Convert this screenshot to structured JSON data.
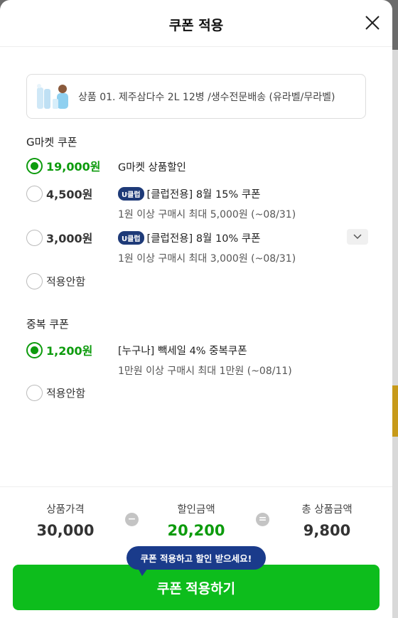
{
  "header": {
    "title": "쿠폰 적용"
  },
  "product": {
    "name": "상품 01. 제주삼다수 2L 12병 /생수전문배송 (유라벨/무라벨)"
  },
  "gmarket_coupons": {
    "title": "G마켓 쿠폰",
    "options": [
      {
        "amount": "19,000원",
        "selected": true,
        "badge": "",
        "desc": "G마켓 상품할인",
        "sub": ""
      },
      {
        "amount": "4,500원",
        "selected": false,
        "badge": "U클럽",
        "desc": "[클럽전용] 8월 15% 쿠폰",
        "sub": "1원 이상 구매시 최대 5,000원 (~08/31)"
      },
      {
        "amount": "3,000원",
        "selected": false,
        "badge": "U클럽",
        "desc": "[클럽전용] 8월 10% 쿠폰",
        "sub": "1원 이상 구매시 최대 3,000원 (~08/31)"
      }
    ],
    "none_label": "적용안함"
  },
  "duplicate_coupons": {
    "title": "중복 쿠폰",
    "options": [
      {
        "amount": "1,200원",
        "selected": true,
        "desc": "[누구나] 빽세일 4% 중복쿠폰",
        "sub": "1만원 이상 구매시 최대 1만원 (~08/11)"
      }
    ],
    "none_label": "적용안함"
  },
  "summary": {
    "price_label": "상품가격",
    "price_value": "30,000",
    "minus": "−",
    "discount_label": "할인금액",
    "discount_value": "20,200",
    "equals": "=",
    "total_label": "총 상품금액",
    "total_value": "9,800"
  },
  "tooltip": "쿠폰 적용하고 할인 받으세요!",
  "apply_button": "쿠폰 적용하기",
  "colors": {
    "accent_green": "#0dbd1c",
    "selected_green": "#0d9b0d",
    "badge_navy": "#1e3a78"
  }
}
